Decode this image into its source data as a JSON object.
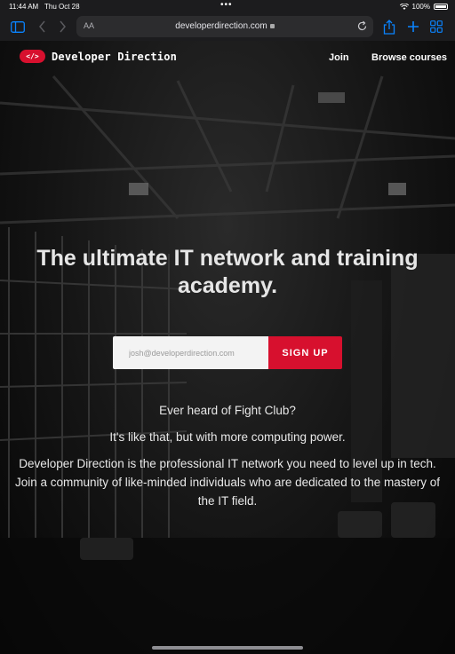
{
  "status_bar": {
    "time": "11:44 AM",
    "date": "Thu Oct 28",
    "battery": "100%"
  },
  "browser": {
    "address_aa": "AA",
    "url": "developerdirection.com"
  },
  "nav": {
    "logo_text": "</>",
    "brand": "Developer Direction",
    "links": [
      "Join",
      "Browse courses"
    ]
  },
  "hero": {
    "headline": "The ultimate IT network and training academy.",
    "email_placeholder": "josh@developerdirection.com",
    "signup_label": "SIGN UP",
    "line1": "Ever heard of Fight Club?",
    "line2": "It's like that, but with more computing power.",
    "line3": "Developer Direction is the professional IT network you need to level up in tech. Join a community of like-minded individuals who are dedicated to the mastery of the IT field."
  },
  "colors": {
    "accent": "#d7102e",
    "safari_blue": "#0a84ff"
  },
  "icons": [
    "sidebar-icon",
    "back-icon",
    "forward-icon",
    "lock-icon",
    "reload-icon",
    "share-icon",
    "new-tab-icon",
    "tabs-grid-icon",
    "wifi-icon",
    "battery-icon"
  ]
}
